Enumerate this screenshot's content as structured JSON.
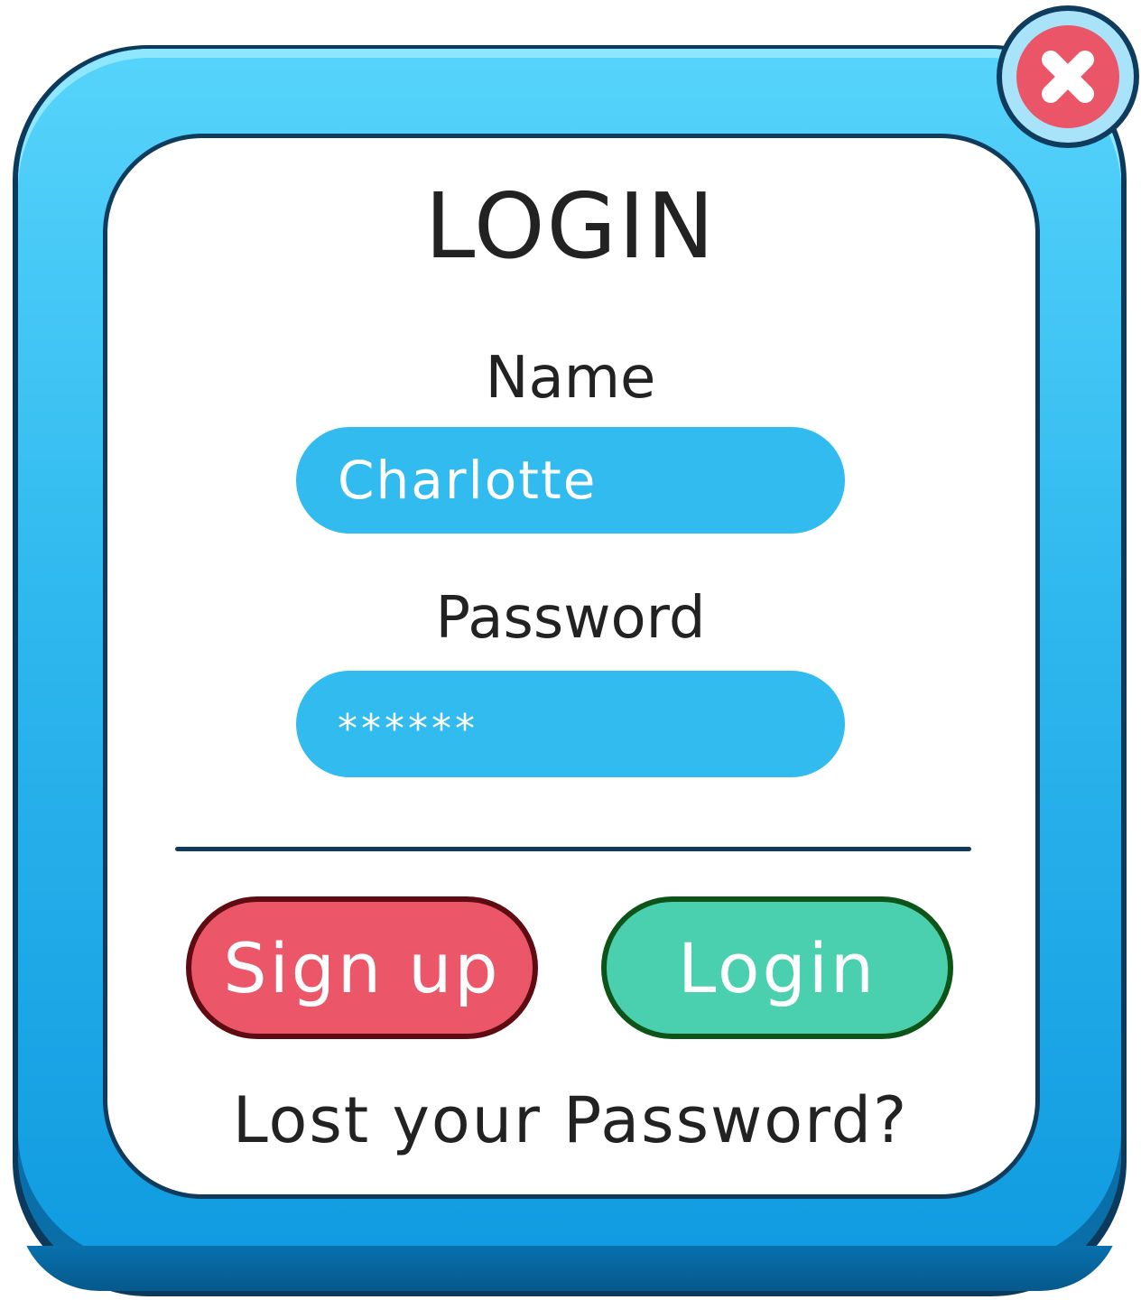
{
  "dialog": {
    "title": "LOGIN",
    "close_icon": "close-x-icon"
  },
  "form": {
    "name_label": "Name",
    "name_value": "Charlotte",
    "password_label": "Password",
    "password_value": "******"
  },
  "buttons": {
    "signup_label": "Sign up",
    "login_label": "Login"
  },
  "footer": {
    "lost_password_link": "Lost your Password?"
  },
  "colors": {
    "frame_blue": "#2fb8ee",
    "field_blue": "#32bbef",
    "signup_red": "#eb5669",
    "login_green": "#4acfaf",
    "close_red": "#ea5568",
    "outline_navy": "#0f3c5d"
  }
}
